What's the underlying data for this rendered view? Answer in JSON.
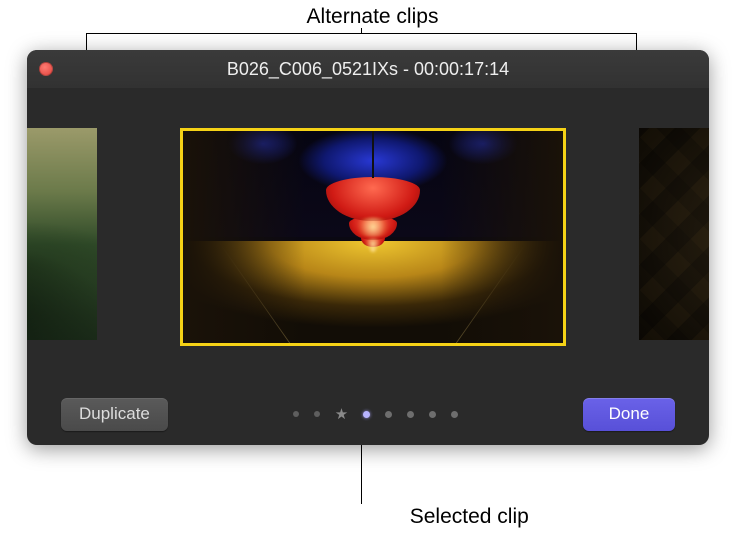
{
  "callouts": {
    "top_label": "Alternate clips",
    "bottom_label": "Selected clip"
  },
  "window": {
    "title": "B026_C006_0521IXs - 00:00:17:14",
    "traffic_light_close_color": "#e0443e"
  },
  "clips": {
    "selected_border_color": "#f5d216",
    "left_alt_name": "forest-hill-clip",
    "right_alt_name": "geometric-bronze-clip",
    "center_name": "tunnel-lights-clip"
  },
  "controls": {
    "duplicate_label": "Duplicate",
    "done_label": "Done",
    "pager": {
      "count": 8,
      "active_index": 3,
      "star_index": 2
    }
  },
  "colors": {
    "accent": "#5850d8",
    "window_bg": "#2a2a2a"
  }
}
